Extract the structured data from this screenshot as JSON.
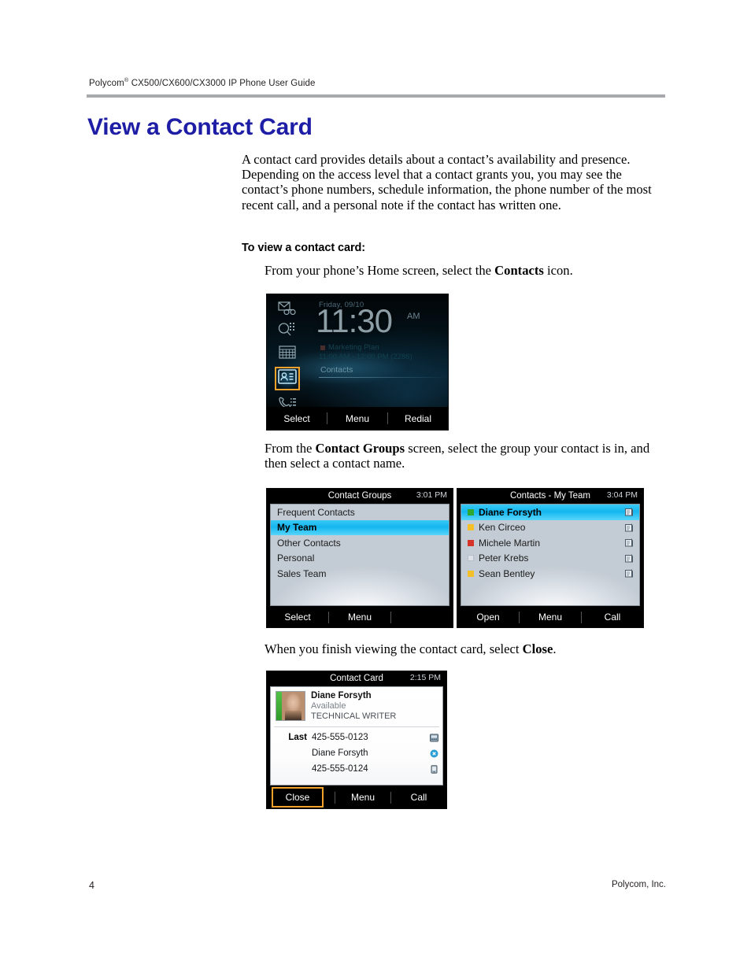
{
  "header": {
    "running_head_prefix": "Polycom",
    "running_head_sup": "®",
    "running_head_rest": " CX500/CX600/CX3000 IP Phone User Guide"
  },
  "heading": "View a Contact Card",
  "intro_paragraph": "A contact card provides details about a contact’s availability and presence. Depending on the access level that a contact grants you, you may see the contact’s phone numbers, schedule information, the phone number of the most recent call, and a personal note if the contact has written one.",
  "sub_head": "To view a contact card:",
  "steps": {
    "step1_before": "From your phone’s Home screen, select the ",
    "step1_bold": "Contacts",
    "step1_after": " icon.",
    "step2_before": "From the ",
    "step2_bold": "Contact Groups",
    "step2_after": " screen, select the group your contact is in, and then select a contact name.",
    "step3_before": "When you finish viewing the contact card, select ",
    "step3_bold": "Close",
    "step3_after": "."
  },
  "home_screen": {
    "date": "Friday, 09/10",
    "time": "11:30",
    "ampm": "AM",
    "meeting_title": "Marketing Plan",
    "meeting_detail": "11:00 AM - 12:00 PM (2286)",
    "contacts_label": "Contacts",
    "icons": [
      "voicemail-icon",
      "search-icon",
      "calendar-icon",
      "contacts-icon",
      "call-history-icon"
    ],
    "selected_icon": "contacts-icon",
    "softkeys": [
      "Select",
      "Menu",
      "Redial"
    ],
    "highlight_color": "#f2a12a"
  },
  "contact_groups_screen": {
    "title": "Contact Groups",
    "time": "3:01 PM",
    "rows": [
      {
        "label": "Frequent Contacts",
        "selected": false
      },
      {
        "label": "My Team",
        "selected": true
      },
      {
        "label": "Other Contacts",
        "selected": false
      },
      {
        "label": "Personal",
        "selected": false
      },
      {
        "label": "Sales Team",
        "selected": false
      }
    ],
    "softkeys": [
      "Select",
      "Menu",
      ""
    ]
  },
  "my_team_screen": {
    "title": "Contacts - My Team",
    "time": "3:04 PM",
    "rows": [
      {
        "label": "Diane Forsyth",
        "presence": "#2fa832",
        "selected": true
      },
      {
        "label": "Ken Circeo",
        "presence": "#f4c02a",
        "selected": false
      },
      {
        "label": "Michele Martin",
        "presence": "#d6342a",
        "selected": false
      },
      {
        "label": "Peter Krebs",
        "presence": "#dde2e8",
        "selected": false
      },
      {
        "label": "Sean Bentley",
        "presence": "#f4c02a",
        "selected": false
      }
    ],
    "softkeys": [
      "Open",
      "Menu",
      "Call"
    ]
  },
  "contact_card_screen": {
    "title": "Contact Card",
    "time": "2:15 PM",
    "name": "Diane Forsyth",
    "status": "Available",
    "job_title": "TECHNICAL WRITER",
    "presence_color": "#3faa36",
    "rows": [
      {
        "label": "Last",
        "value": "425-555-0123",
        "icon": "work-phone-icon"
      },
      {
        "label": "",
        "value": "Diane Forsyth",
        "icon": "im-icon"
      },
      {
        "label": "",
        "value": "425-555-0124",
        "icon": "mobile-phone-icon"
      }
    ],
    "softkeys": [
      "Close",
      "Menu",
      "Call"
    ],
    "highlighted_softkey": "Close",
    "highlight_color": "#f2a12a"
  },
  "footer": {
    "page_number": "4",
    "company": "Polycom, Inc."
  }
}
